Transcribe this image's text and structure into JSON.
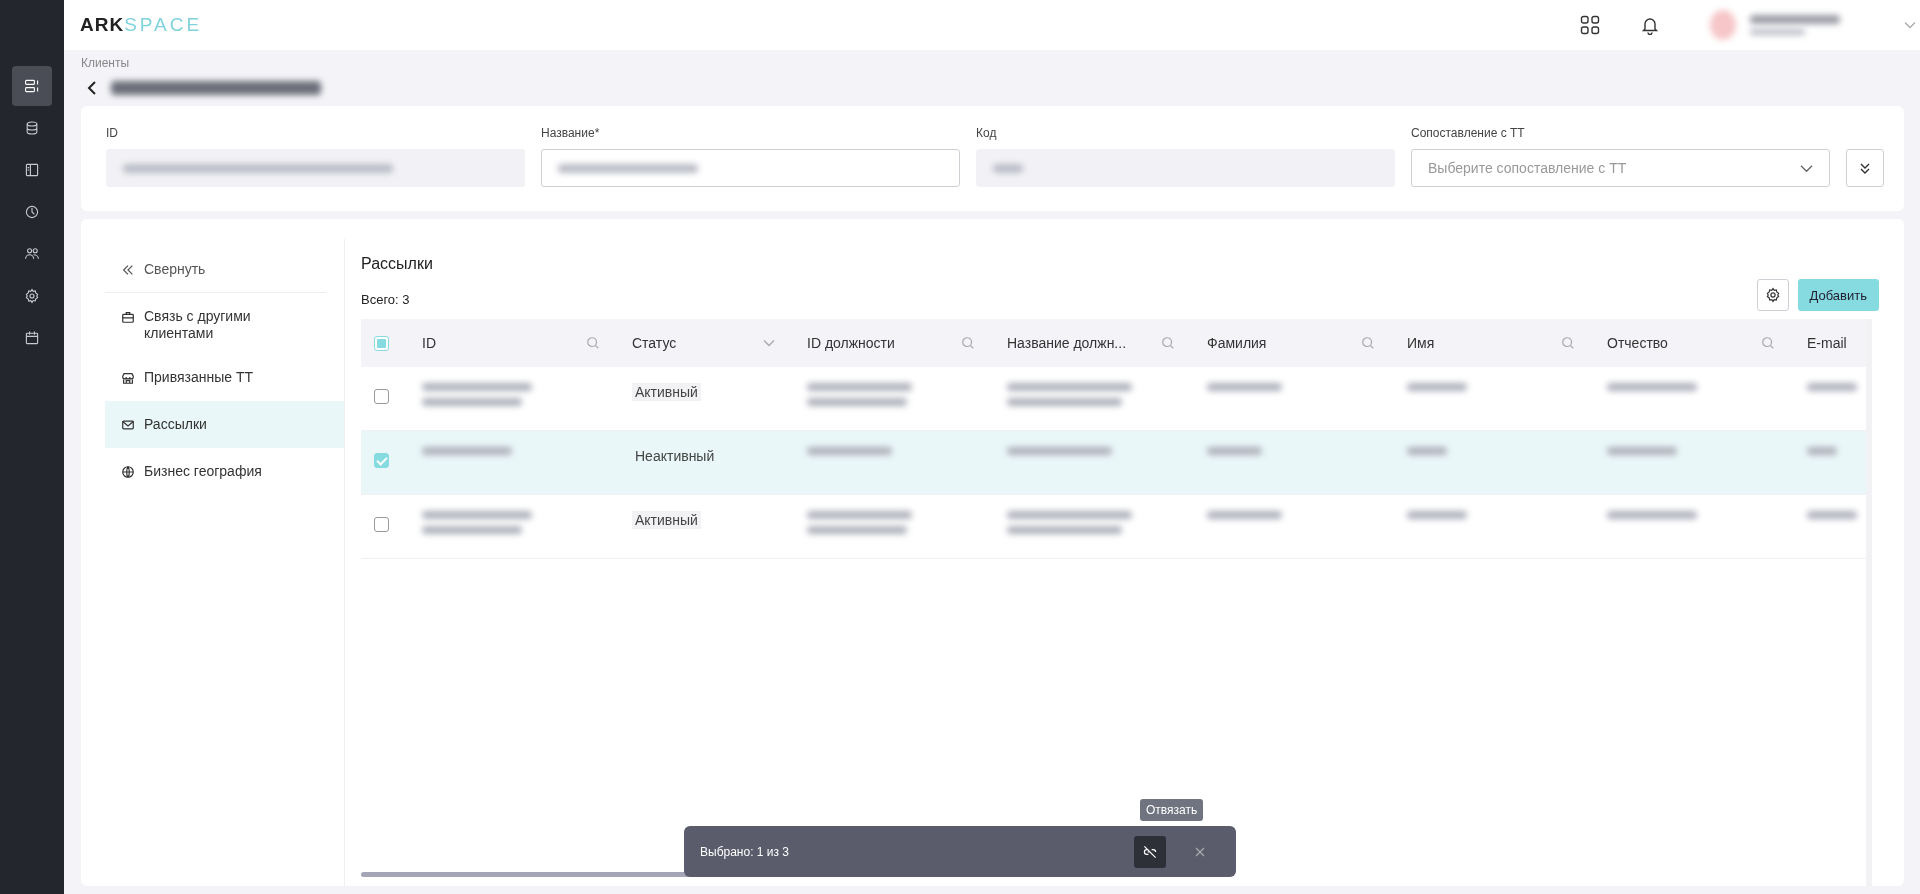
{
  "logo": {
    "part_1": "ARK",
    "part_2": "SPACE"
  },
  "rail": [
    {
      "kind": "layout",
      "selected": true
    },
    {
      "kind": "database",
      "selected": false
    },
    {
      "kind": "panel",
      "selected": false
    },
    {
      "kind": "chart",
      "selected": false
    },
    {
      "kind": "users",
      "selected": false
    },
    {
      "kind": "settings",
      "selected": false
    },
    {
      "kind": "calendar",
      "selected": false
    }
  ],
  "breadcrumb": "Клиенты",
  "form": {
    "fields": [
      {
        "label": "ID",
        "kind": "readonly"
      },
      {
        "label": "Название*",
        "kind": "input"
      },
      {
        "label": "Код",
        "kind": "readonly"
      },
      {
        "label": "Сопоставление с ТТ",
        "kind": "select",
        "placeholder": "Выберите сопоставление с ТТ"
      }
    ]
  },
  "nav": [
    {
      "kind": "collapse",
      "label": "Свернуть",
      "selected": false
    },
    {
      "kind": "briefcase",
      "label": "Связь с другими клиентами",
      "selected": false
    },
    {
      "kind": "store",
      "label": "Привязанные ТТ",
      "selected": false
    },
    {
      "kind": "mail",
      "label": "Рассылки",
      "selected": true
    },
    {
      "kind": "globe",
      "label": "Бизнес география",
      "selected": false
    }
  ],
  "section": {
    "title": "Рассылки",
    "total": "Всего: 3",
    "add_button": "Добавить"
  },
  "table": {
    "select_all": {
      "indeterminate": true
    },
    "columns": [
      {
        "label": "ID",
        "kind": "search"
      },
      {
        "label": "Статус",
        "kind": "select"
      },
      {
        "label": "ID должности",
        "kind": "search"
      },
      {
        "label": "Название должн...",
        "kind": "search"
      },
      {
        "label": "Фамилия",
        "kind": "search"
      },
      {
        "label": "Имя",
        "kind": "search"
      },
      {
        "label": "Отчество",
        "kind": "search"
      },
      {
        "label": "E-mail",
        "kind": "plain"
      }
    ],
    "rows": [
      {
        "selected": false,
        "status": "Активный"
      },
      {
        "selected": true,
        "status": "Неактивный"
      },
      {
        "selected": false,
        "status": "Активный"
      }
    ]
  },
  "selection_bar": {
    "text": "Выбрано: 1 из 3",
    "tooltip": "Отвязать"
  }
}
